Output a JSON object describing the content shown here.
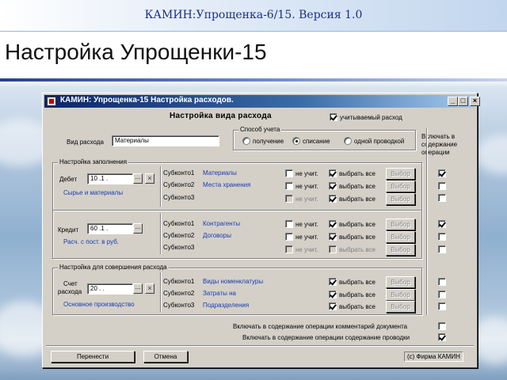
{
  "slide": {
    "subtitle": "КАМИН:Упрощенка-6/15. Версия 1.0",
    "title": "Настройка Упрощенки-15"
  },
  "window": {
    "title": "КАМИН: Упрощенка-15  Настройка расходов.",
    "min_glyph": "_",
    "max_glyph": "□",
    "close_glyph": "×"
  },
  "form": {
    "heading": "Настройка вида расхода",
    "tracked_label": "учитываемый расход",
    "tracked_checked": true,
    "expense_kind_label": "Вид расхода",
    "expense_kind_value": "Материалы",
    "accounting": {
      "title": "Способ учета",
      "options": [
        "получение",
        "списание",
        "одной проводкой"
      ],
      "selected": "списание"
    },
    "include_label": "Включать в содержание операции"
  },
  "fill_settings": {
    "title": "Настройка заполнения",
    "debit": {
      "label": "Дебет",
      "account": "10 .1 .",
      "account_name": "Сырье и материалы",
      "picker_glyph": "...",
      "clear_glyph": "×",
      "rows": [
        {
          "sub": "Субконто1",
          "value": "Материалы",
          "not_tracked": "не учит.",
          "not_tracked_checked": false,
          "select_all": "выбрать все",
          "select_all_checked": true,
          "choose": "Выбор",
          "include_checked": true
        },
        {
          "sub": "Субконто2",
          "value": "Места хранения",
          "not_tracked": "не учит.",
          "not_tracked_checked": false,
          "select_all": "выбрать все",
          "select_all_checked": true,
          "choose": "Выбор",
          "include_checked": false
        },
        {
          "sub": "Субконто3",
          "value": "",
          "not_tracked": "не учит.",
          "not_tracked_checked": false,
          "select_all": "выбрать все",
          "select_all_checked": true,
          "choose": "Выбор",
          "include_checked": false
        }
      ]
    },
    "credit": {
      "label": "Кредит",
      "account": "60 .1 .",
      "account_name": "Расч. с пост. в руб.",
      "picker_glyph": "...",
      "rows": [
        {
          "sub": "Субконто1",
          "value": "Контрагенты",
          "not_tracked": "не учит.",
          "not_tracked_checked": false,
          "select_all": "выбрать все",
          "select_all_checked": true,
          "choose": "Выбор",
          "include_checked": true
        },
        {
          "sub": "Субконто2",
          "value": "Договоры",
          "not_tracked": "не учит.",
          "not_tracked_checked": false,
          "select_all": "выбрать все",
          "select_all_checked": true,
          "choose": "Выбор",
          "include_checked": false
        },
        {
          "sub": "Субконто3",
          "value": "",
          "not_tracked": "не учит.",
          "not_tracked_checked": false,
          "select_all": "выбрать все",
          "select_all_checked": false,
          "choose": "Выбор",
          "include_checked": false
        }
      ]
    }
  },
  "expense_settings": {
    "title": "Настройка для совершения расхода",
    "account_label_1": "Счет",
    "account_label_2": "расхода",
    "account": "20 .  .",
    "account_name": "Основное производство",
    "picker_glyph": "...",
    "clear_glyph": "×",
    "rows": [
      {
        "sub": "Субконто1",
        "value": "Виды номенклатуры",
        "select_all": "выбрать все",
        "select_all_checked": true,
        "choose": "Выбор",
        "include_checked": false
      },
      {
        "sub": "Субконто2",
        "value": "Затраты на",
        "select_all": "выбрать все",
        "select_all_checked": true,
        "choose": "Выбор",
        "include_checked": false
      },
      {
        "sub": "Субконто3",
        "value": "Подразделения",
        "select_all": "выбрать все",
        "select_all_checked": true,
        "choose": "Выбор",
        "include_checked": false
      }
    ]
  },
  "bottom": {
    "include_comment": "Включать в содержание операции комментарий документа",
    "include_comment_checked": false,
    "include_entry": "Включать в содержание операции содержание проводки",
    "include_entry_checked": true,
    "transfer_button": "Перенести",
    "cancel_button": "Отмена",
    "copyright": "(с) Фирма КАМИН"
  },
  "colors": {
    "title_bar": "#0a246a",
    "dialog_bg": "#d4d0c8",
    "link_blue": "#1a3cb0"
  }
}
